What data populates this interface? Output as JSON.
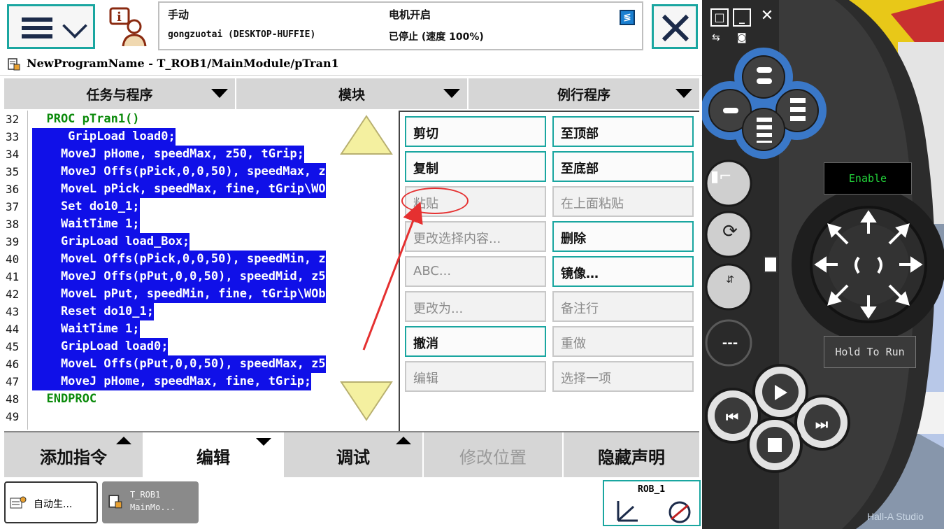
{
  "status": {
    "mode": "手动",
    "host": "gongzuotai (DESKTOP-HUFFIE)",
    "motor": "电机开启",
    "state": "已停止 (速度 100%)"
  },
  "path": "NewProgramName - T_ROB1/MainModule/pTran1",
  "headers": [
    "任务与程序",
    "模块",
    "例行程序"
  ],
  "code": {
    "line_numbers": [
      "32",
      "33",
      "34",
      "35",
      "36",
      "37",
      "38",
      "39",
      "40",
      "41",
      "42",
      "43",
      "44",
      "45",
      "46",
      "47",
      "48",
      "49"
    ],
    "lines": [
      "  PROC pTran1()",
      "     GripLoad load0;",
      "    MoveJ pHome, speedMax, z50, tGrip;",
      "    MoveJ Offs(pPick,0,0,50), speedMax, z",
      "    MoveL pPick, speedMax, fine, tGrip\\WO",
      "    Set do10_1;",
      "    WaitTime 1;",
      "    GripLoad load_Box;",
      "    MoveL Offs(pPick,0,0,50), speedMin, z",
      "    MoveJ Offs(pPut,0,0,50), speedMid, z5",
      "    MoveL pPut, speedMin, fine, tGrip\\WOb",
      "    Reset do10_1;",
      "    WaitTime 1;",
      "    GripLoad load0;",
      "    MoveL Offs(pPut,0,0,50), speedMax, z5",
      "    MoveJ pHome, speedMax, fine, tGrip;",
      "  ENDPROC",
      ""
    ]
  },
  "edit_menu": {
    "cut": "剪切",
    "to_top": "至顶部",
    "copy": "复制",
    "to_bottom": "至底部",
    "paste": "粘贴",
    "paste_above": "在上面粘贴",
    "change_selection": "更改选择内容...",
    "delete": "删除",
    "abc": "ABC...",
    "mirror": "镜像…",
    "change_to": "更改为...",
    "comment": "备注行",
    "undo": "撤消",
    "redo": "重做",
    "edit": "编辑",
    "select_one": "选择一项"
  },
  "bottom": {
    "add_instruction": "添加指令",
    "edit": "编辑",
    "debug": "调试",
    "modify_position": "修改位置",
    "hide_declarations": "隐藏声明"
  },
  "tasks": {
    "task1": "自动生...",
    "task2_line1": "T_ROB1",
    "task2_line2": "MainMo...",
    "rob": "ROB_1"
  },
  "device": {
    "enable": "Enable",
    "hold_to_run": "Hold To Run",
    "watermark": "Hall-A Studio"
  },
  "colors": {
    "selection": "#1010e8",
    "accent": "#1aa6a0",
    "highlight": "#e53030",
    "keyword": "#0a8a0a"
  }
}
